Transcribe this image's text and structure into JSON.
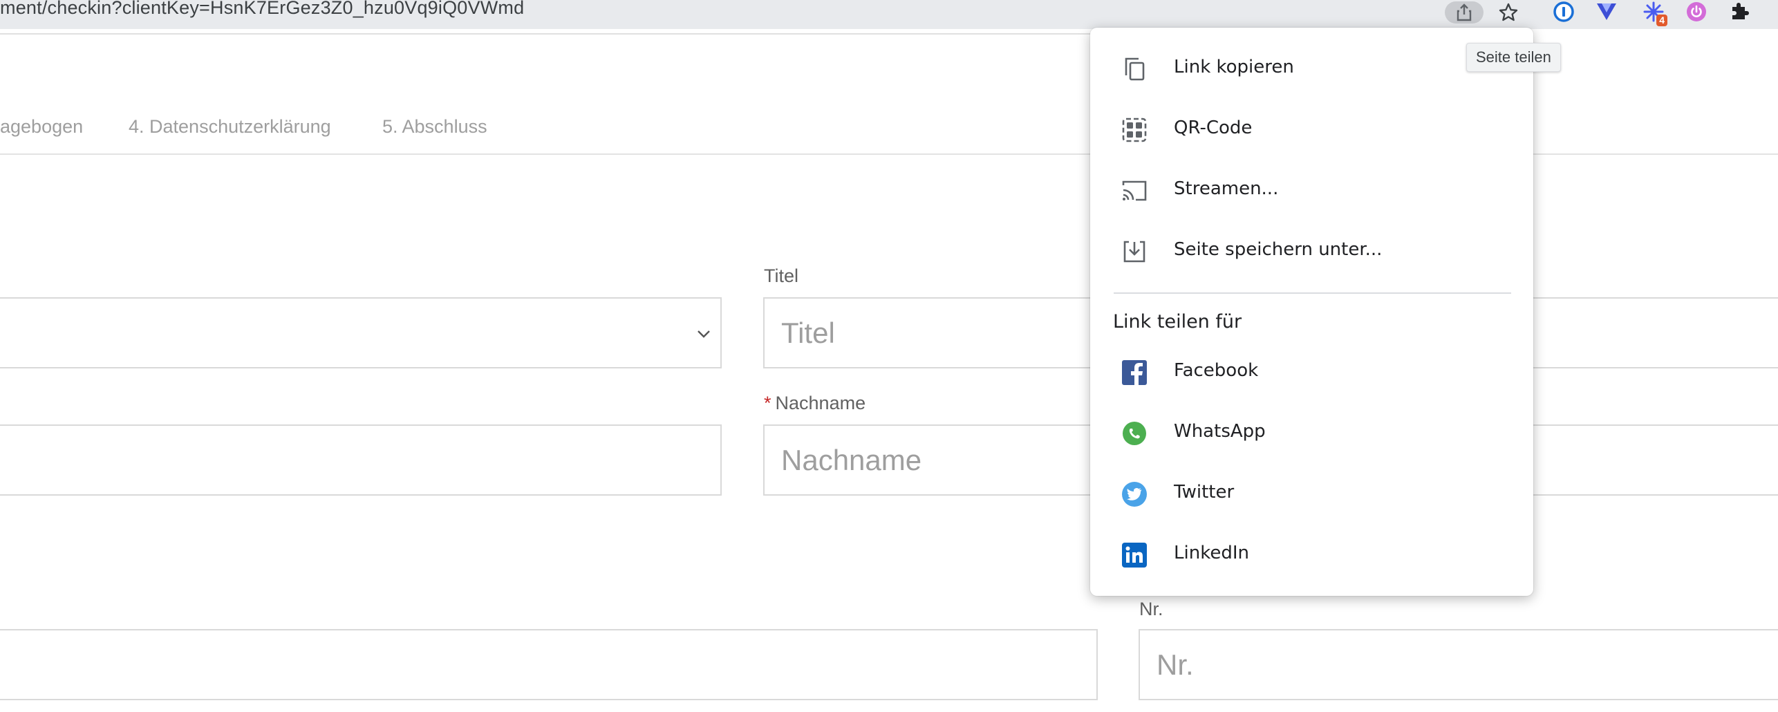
{
  "browser": {
    "url": "ment/checkin?clientKey=HsnK7ErGez3Z0_hzu0Vq9iQ0VWmd",
    "tooltip": "Seite teilen",
    "extension_badge": "4"
  },
  "steps": [
    "agebogen",
    "4. Datenschutzerklärung",
    "5. Abschluss"
  ],
  "form": {
    "title_label": "Titel",
    "title_placeholder": "Titel",
    "lastname_required": "*",
    "lastname_label": "Nachname",
    "lastname_placeholder": "Nachname",
    "nr_label": "Nr.",
    "nr_placeholder": "Nr."
  },
  "share_menu": {
    "items": [
      {
        "label": "Link kopieren",
        "icon": "copy-icon"
      },
      {
        "label": "QR-Code",
        "icon": "qr-code-icon"
      },
      {
        "label": "Streamen...",
        "icon": "cast-icon"
      },
      {
        "label": "Seite speichern unter...",
        "icon": "save-page-icon"
      }
    ],
    "section_heading": "Link teilen für",
    "social": [
      {
        "label": "Facebook",
        "icon": "facebook-icon",
        "color": "#3b5998"
      },
      {
        "label": "WhatsApp",
        "icon": "whatsapp-icon",
        "color": "#4caf50"
      },
      {
        "label": "Twitter",
        "icon": "twitter-icon",
        "color": "#1da1f2"
      },
      {
        "label": "LinkedIn",
        "icon": "linkedin-icon",
        "color": "#0a66c2"
      }
    ]
  },
  "colors": {
    "highlight": "#86a330",
    "required": "#c62828"
  }
}
